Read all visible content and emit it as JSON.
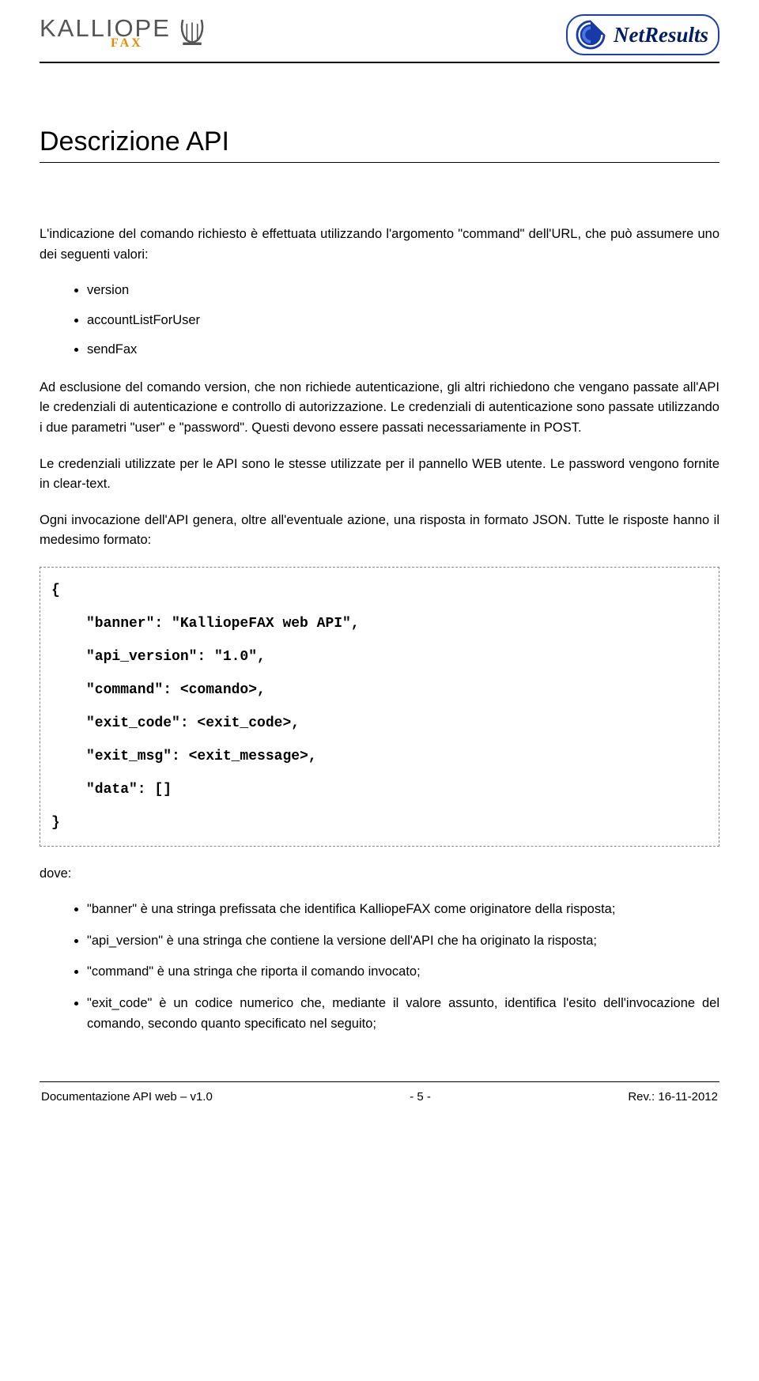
{
  "header": {
    "logo_left_main": "KALLIOPE",
    "logo_left_sub": "FAX",
    "logo_right": "NetResults"
  },
  "title": "Descrizione API",
  "body": {
    "p1": "L'indicazione del comando richiesto è effettuata utilizzando l'argomento \"command\" dell'URL, che può assumere uno dei seguenti valori:",
    "commands": [
      "version",
      "accountListForUser",
      "sendFax"
    ],
    "p2": "Ad esclusione del comando version, che non richiede autenticazione, gli altri richiedono che vengano passate all'API le credenziali di autenticazione e controllo di autorizzazione. Le credenziali di autenticazione sono passate utilizzando i due parametri \"user\" e \"password\". Questi devono essere passati necessariamente in POST.",
    "p3": "Le credenziali utilizzate per le API sono le stesse utilizzate per il pannello WEB utente. Le password vengono fornite in clear-text.",
    "p4": "Ogni invocazione dell'API genera, oltre all'eventuale azione, una risposta in formato JSON. Tutte le risposte hanno il medesimo formato:",
    "code": {
      "open": "{",
      "l1": "\"banner\": \"KalliopeFAX web API\",",
      "l2": "\"api_version\": \"1.0\",",
      "l3": "\"command\": <comando>,",
      "l4": "\"exit_code\": <exit_code>,",
      "l5": "\"exit_msg\": <exit_message>,",
      "l6": "\"data\": []",
      "close": "}"
    },
    "dove": "dove:",
    "bullets": [
      "\"banner\" è una stringa prefissata che identifica KalliopeFAX come originatore della risposta;",
      "\"api_version\" è una stringa che contiene la versione dell'API che ha originato la risposta;",
      "\"command\" è una stringa che riporta il comando invocato;",
      "\"exit_code\" è un codice numerico che, mediante il valore assunto, identifica l'esito dell'invocazione del comando, secondo quanto specificato nel seguito;"
    ]
  },
  "footer": {
    "left": "Documentazione API web – v1.0",
    "center": "- 5 -",
    "right": "Rev.: 16-11-2012"
  }
}
